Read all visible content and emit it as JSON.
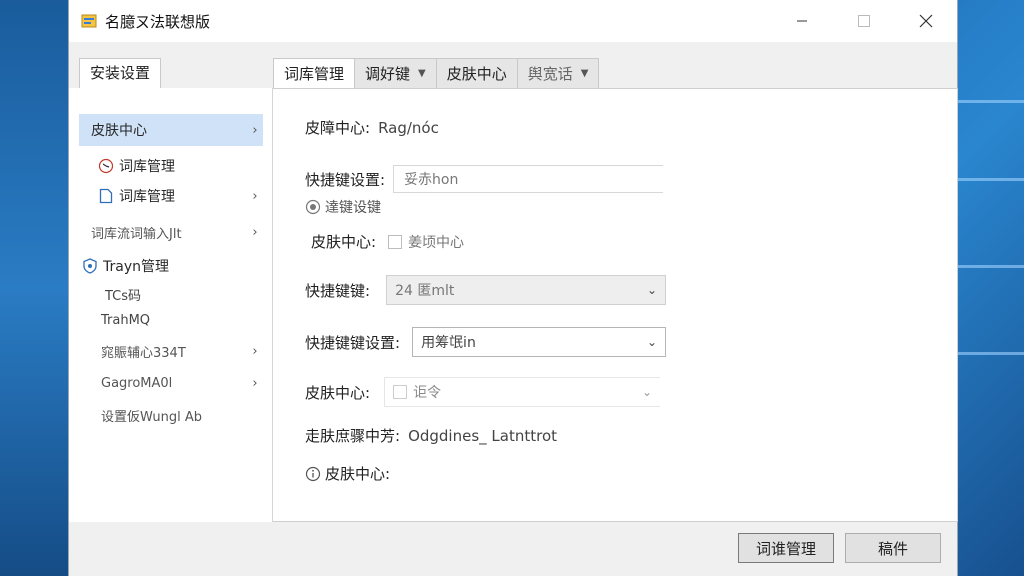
{
  "window": {
    "title": "名臆ㄡ法联想版"
  },
  "left_tab": {
    "label": "安装设置"
  },
  "nav": [
    {
      "label": "皮肤中心",
      "chevron": "›",
      "icon": "",
      "selected": true
    },
    {
      "label": "词库管理",
      "chevron": "",
      "icon": "clock-icon"
    },
    {
      "label": "词库管理",
      "chevron": "›",
      "icon": "document-icon"
    },
    {
      "label": "词库流词输入Jlt",
      "chevron": "›",
      "icon": ""
    },
    {
      "label": "Trayn管理",
      "chevron": "",
      "icon": "shield-icon"
    },
    {
      "label": "TCs码",
      "chevron": "",
      "icon": ""
    },
    {
      "label": "TrahMQ",
      "chevron": "",
      "icon": ""
    },
    {
      "label": "窕賑辅心334T",
      "chevron": "›",
      "icon": ""
    },
    {
      "label": "GagroMA0l",
      "chevron": "›",
      "icon": ""
    },
    {
      "label": "设置仮Wungl Ab",
      "chevron": "",
      "icon": ""
    }
  ],
  "tabs": [
    {
      "label": "词库管理",
      "dropdown": false,
      "active": true
    },
    {
      "label": "调好键",
      "dropdown": true,
      "active": false
    },
    {
      "label": "皮肤中心",
      "dropdown": false,
      "active": false
    },
    {
      "label": "舆宽话",
      "dropdown": true,
      "active": false
    }
  ],
  "form": {
    "skin_center": {
      "label": "皮障中心:",
      "value": "Rag/nóc"
    },
    "shortcut_settings": {
      "label": "快捷键设置:",
      "placeholder": "妥赤hon"
    },
    "shortcut_radio": {
      "label": "達键设键"
    },
    "skin_center_check": {
      "label": "皮肤中心:",
      "check_label": "姜顷中心"
    },
    "shortcut_key": {
      "label": "快捷键键:",
      "value": "24 匿mlt"
    },
    "shortcut_key_settings": {
      "label": "快捷键键设置:",
      "value": "用筹氓in"
    },
    "skin_center_combo": {
      "label": "皮肤中心:",
      "value": "讵令"
    },
    "skin_module": {
      "label": "走肤庶骤中芳:",
      "value": "Odgdines_ Latnttrot"
    },
    "skin_center_bottom": {
      "label": "皮肤中心:"
    }
  },
  "buttons": {
    "primary": "词谁管理",
    "secondary": "稿件"
  },
  "colors": {
    "selected_bg": "#cfe2f7",
    "desktop_blue": "#1d6db5"
  }
}
